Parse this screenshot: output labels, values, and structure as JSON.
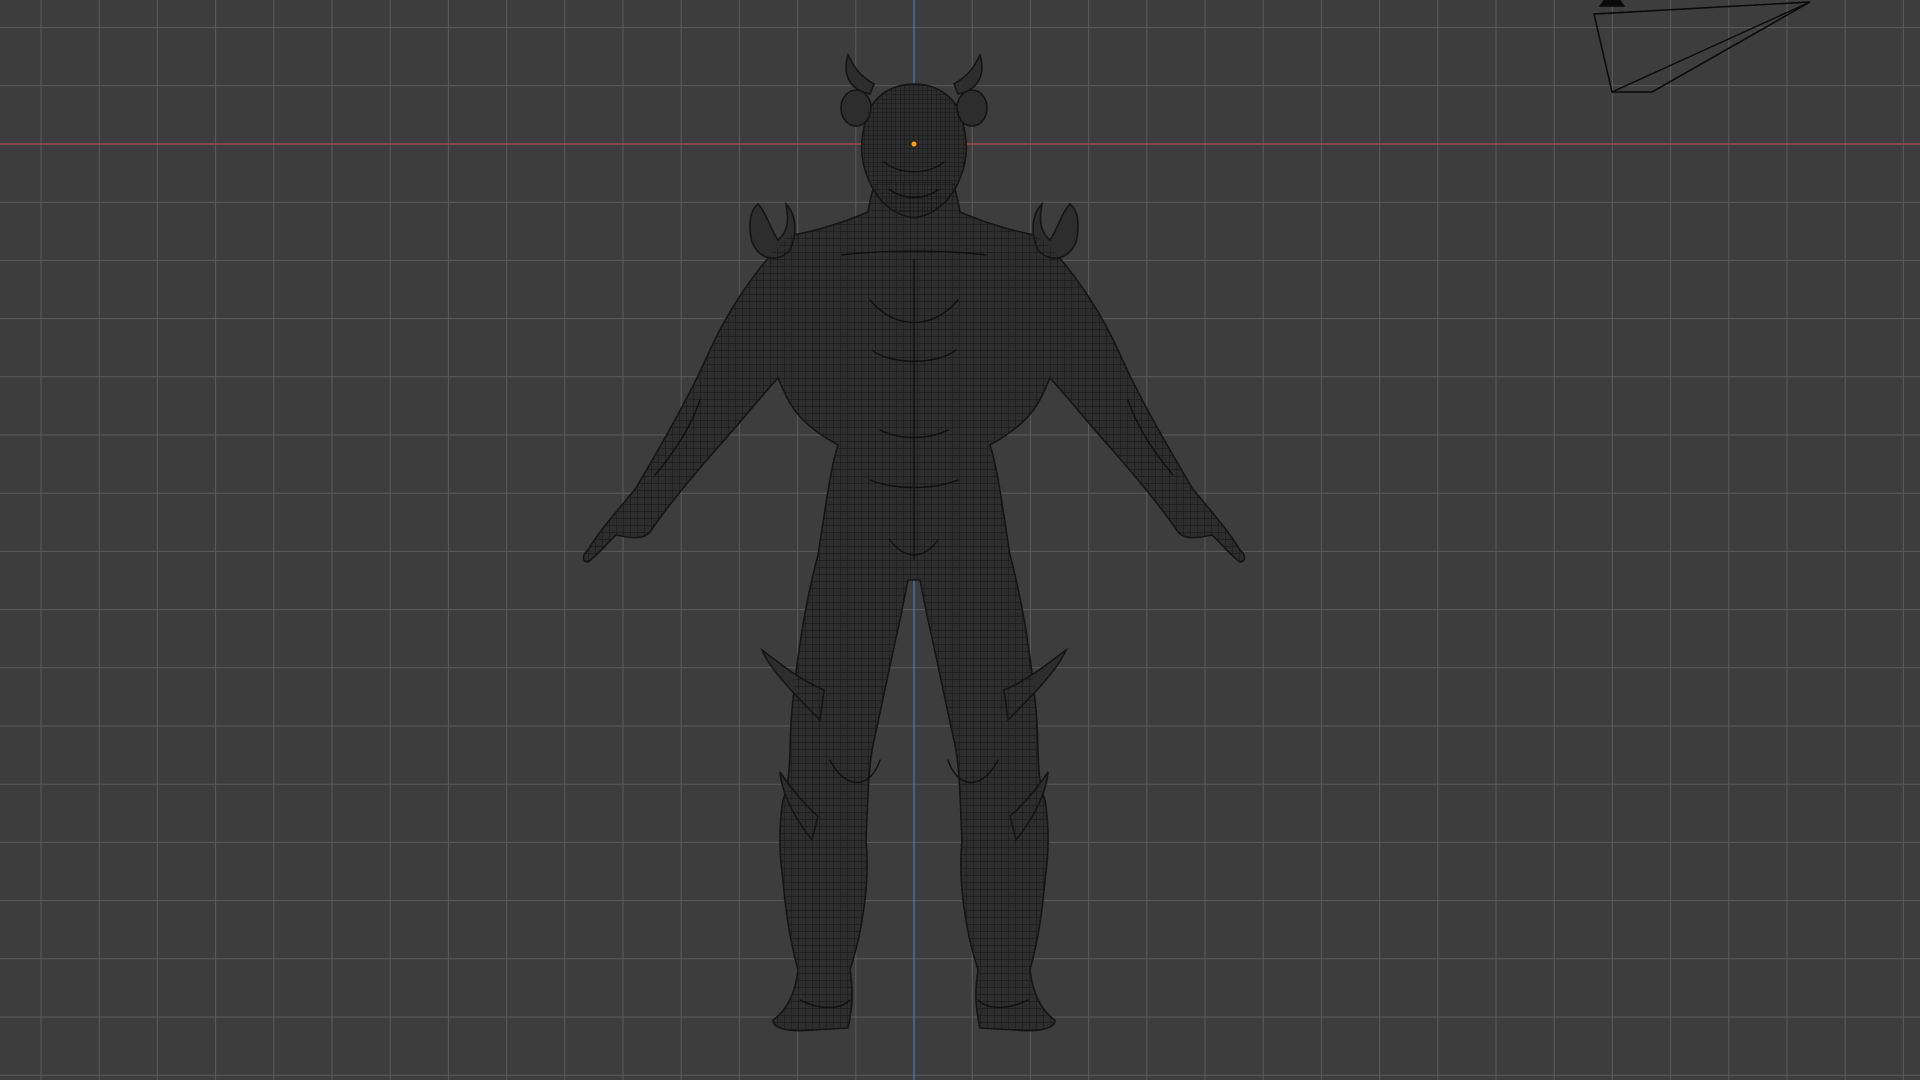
{
  "viewport": {
    "background_color": "#3d3d3d",
    "grid_minor_color": "#4a4a4a",
    "grid_major_color": "#5b5b5b",
    "x_axis_color": "#b54b56",
    "y_axis_color": "#4a7ab8",
    "origin_color": "#ff9a1f",
    "mesh_fill_color": "#2d2d2d",
    "mesh_wire_color": "#141414",
    "camera_color": "#0a0a0a"
  },
  "scene": {
    "object": "horned-demon-character-mesh",
    "display_mode": "wireframe",
    "pose": "A-pose",
    "view": "front-orthographic",
    "camera_object": "camera-icon"
  }
}
